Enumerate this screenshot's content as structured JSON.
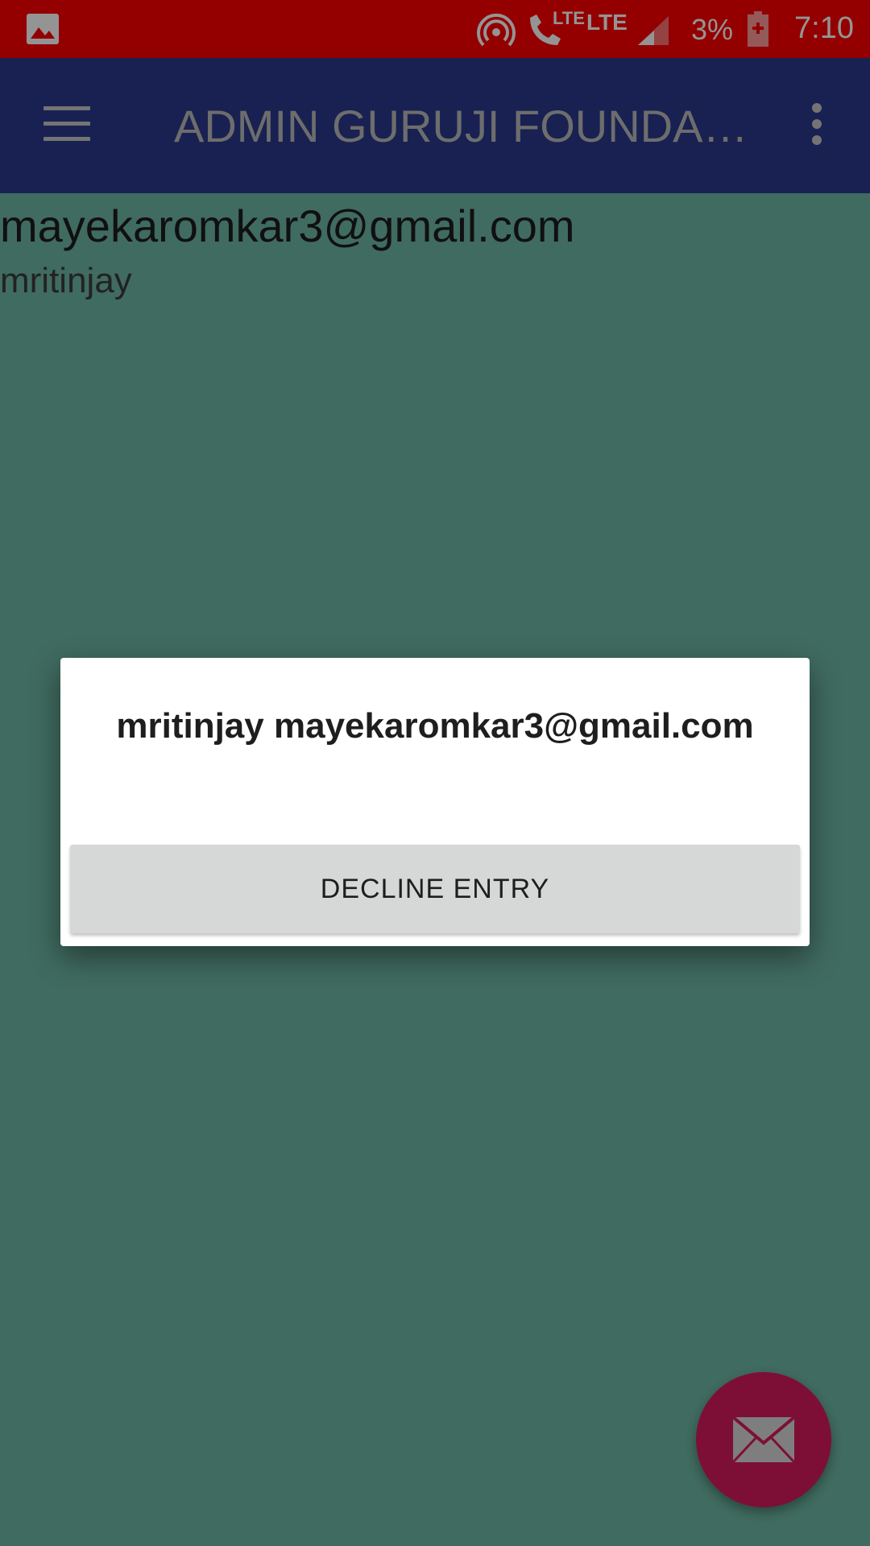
{
  "status_bar": {
    "lte_call_label": "LTE",
    "lte_label": "LTE",
    "battery_percent": "3%",
    "time": "7:10",
    "icons": [
      "gallery-icon",
      "hotspot-icon",
      "volte-call-icon",
      "signal-icon",
      "battery-charging-icon"
    ]
  },
  "app_bar": {
    "title": "ADMIN GURUJI FOUNDA…",
    "icons": [
      "menu-icon",
      "overflow-menu-icon"
    ]
  },
  "entry": {
    "email": "mayekaromkar3@gmail.com",
    "name": "mritinjay"
  },
  "dialog": {
    "message": "mritinjay mayekaromkar3@gmail.com",
    "decline_label": "DECLINE ENTRY"
  },
  "fab": {
    "icon": "mail-icon",
    "color": "#d81b60"
  },
  "colors": {
    "status_bar": "#ff0000",
    "app_bar": "#2b3a8e",
    "background": "#6fb9a5"
  }
}
